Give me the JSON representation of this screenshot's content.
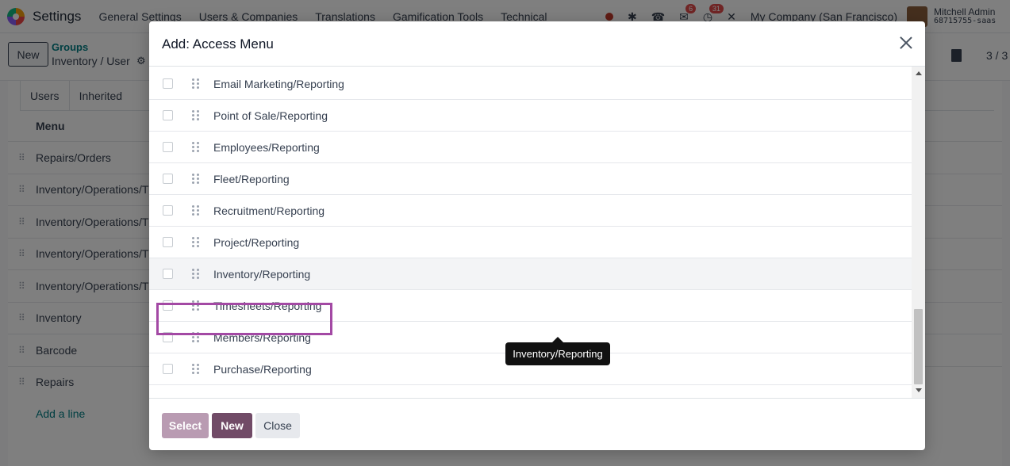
{
  "app": {
    "name": "Settings",
    "nav": [
      "General Settings",
      "Users & Companies",
      "Translations",
      "Gamification Tools",
      "Technical"
    ],
    "badges": {
      "messages": "6",
      "activities": "31"
    },
    "company": "My Company (San Francisco)",
    "user_name": "Mitchell Admin",
    "user_db": "68715755-saas"
  },
  "control": {
    "new_label": "New",
    "breadcrumb_parent": "Groups",
    "breadcrumb_current": "Inventory / User",
    "pager": "3 / 3"
  },
  "background": {
    "tabs": [
      "Users",
      "Inherited"
    ],
    "column_header": "Menu",
    "rows": [
      "Repairs/Orders",
      "Inventory/Operations/T",
      "Inventory/Operations/T",
      "Inventory/Operations/T",
      "Inventory/Operations/T",
      "Inventory",
      "Barcode",
      "Repairs"
    ],
    "add_line": "Add a line"
  },
  "modal": {
    "title": "Add: Access Menu",
    "rows": [
      "Email Marketing/Reporting",
      "Point of Sale/Reporting",
      "Employees/Reporting",
      "Fleet/Reporting",
      "Recruitment/Reporting",
      "Project/Reporting",
      "Inventory/Reporting",
      "Timesheets/Reporting",
      "Members/Reporting",
      "Purchase/Reporting"
    ],
    "hovered_row": 6,
    "tooltip": "Inventory/Reporting",
    "buttons": {
      "select": "Select",
      "new": "New",
      "close": "Close"
    }
  },
  "colors": {
    "primary": "#714b67",
    "primary_disabled": "#b99bb2",
    "link": "#017e84",
    "highlight": "#a349a4"
  }
}
